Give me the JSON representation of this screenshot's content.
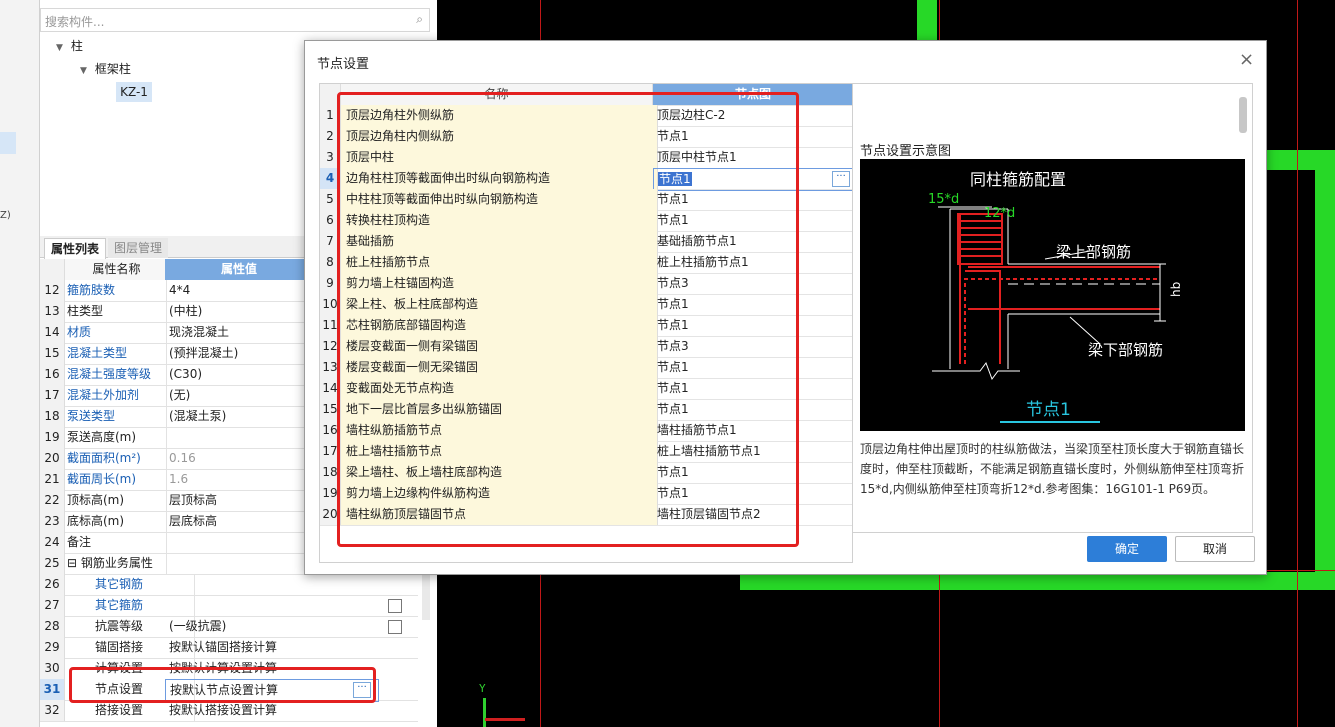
{
  "left_panel": {
    "search_placeholder": "搜索构件...",
    "tree": {
      "root": "柱",
      "child": "框架柱",
      "leaf": "KZ-1"
    },
    "tabs": [
      "属性列表",
      "图层管理"
    ],
    "header": {
      "name": "属性名称",
      "value": "属性值"
    },
    "rows": [
      {
        "num": "12",
        "name": "箍筋肢数",
        "value": "4*4",
        "name_color": "blue"
      },
      {
        "num": "13",
        "name": "柱类型",
        "value": "(中柱)"
      },
      {
        "num": "14",
        "name": "材质",
        "value": "现浇混凝土",
        "name_color": "blue"
      },
      {
        "num": "15",
        "name": "混凝土类型",
        "value": "(预拌混凝土)",
        "name_color": "blue"
      },
      {
        "num": "16",
        "name": "混凝土强度等级",
        "value": "(C30)",
        "name_color": "blue"
      },
      {
        "num": "17",
        "name": "混凝土外加剂",
        "value": "(无)",
        "name_color": "blue"
      },
      {
        "num": "18",
        "name": "泵送类型",
        "value": "(混凝土泵)",
        "name_color": "blue"
      },
      {
        "num": "19",
        "name": "泵送高度(m)",
        "value": ""
      },
      {
        "num": "20",
        "name": "截面面积(m²)",
        "value": "0.16",
        "name_color": "blue",
        "value_color": "gray"
      },
      {
        "num": "21",
        "name": "截面周长(m)",
        "value": "1.6",
        "name_color": "blue",
        "value_color": "gray"
      },
      {
        "num": "22",
        "name": "顶标高(m)",
        "value": "层顶标高"
      },
      {
        "num": "23",
        "name": "底标高(m)",
        "value": "层底标高"
      },
      {
        "num": "24",
        "name": "备注",
        "value": ""
      },
      {
        "num": "25",
        "name": "⊟ 钢筋业务属性",
        "value": ""
      },
      {
        "num": "26",
        "name": "其它钢筋",
        "value": "",
        "name_color": "blue",
        "indent": true
      },
      {
        "num": "27",
        "name": "其它箍筋",
        "value": "",
        "name_color": "blue",
        "indent": true,
        "checkbox": true
      },
      {
        "num": "28",
        "name": "抗震等级",
        "value": "(一级抗震)",
        "indent": true,
        "checkbox": true
      },
      {
        "num": "29",
        "name": "锚固搭接",
        "value": "按默认锚固搭接计算",
        "indent": true
      },
      {
        "num": "30",
        "name": "计算设置",
        "value": "按默认计算设置计算",
        "indent": true
      },
      {
        "num": "31",
        "name": "节点设置",
        "value": "按默认节点设置计算",
        "indent": true,
        "selected": true
      },
      {
        "num": "32",
        "name": "搭接设置",
        "value": "按默认搭接设置计算",
        "indent": true
      }
    ]
  },
  "dialog": {
    "title": "节点设置",
    "close_glyph": "×",
    "header": {
      "name": "名称",
      "value": "节点图"
    },
    "rows": [
      {
        "num": "1",
        "name": "顶层边角柱外侧纵筋",
        "value": "顶层边柱C-2"
      },
      {
        "num": "2",
        "name": "顶层边角柱内侧纵筋",
        "value": "节点1"
      },
      {
        "num": "3",
        "name": "顶层中柱",
        "value": "顶层中柱节点1"
      },
      {
        "num": "4",
        "name": "边角柱柱顶等截面伸出时纵向钢筋构造",
        "value": "节点1",
        "selected": true
      },
      {
        "num": "5",
        "name": "中柱柱顶等截面伸出时纵向钢筋构造",
        "value": "节点1"
      },
      {
        "num": "6",
        "name": "转换柱柱顶构造",
        "value": "节点1"
      },
      {
        "num": "7",
        "name": "基础插筋",
        "value": "基础插筋节点1"
      },
      {
        "num": "8",
        "name": "桩上柱插筋节点",
        "value": "桩上柱插筋节点1"
      },
      {
        "num": "9",
        "name": "剪力墙上柱锚固构造",
        "value": "节点3"
      },
      {
        "num": "10",
        "name": "梁上柱、板上柱底部构造",
        "value": "节点1"
      },
      {
        "num": "11",
        "name": "芯柱钢筋底部锚固构造",
        "value": "节点1"
      },
      {
        "num": "12",
        "name": "楼层变截面一侧有梁锚固",
        "value": "节点3"
      },
      {
        "num": "13",
        "name": "楼层变截面一侧无梁锚固",
        "value": "节点1"
      },
      {
        "num": "14",
        "name": "变截面处无节点构造",
        "value": "节点1"
      },
      {
        "num": "15",
        "name": "地下一层比首层多出纵筋锚固",
        "value": "节点1"
      },
      {
        "num": "16",
        "name": "墙柱纵筋插筋节点",
        "value": "墙柱插筋节点1"
      },
      {
        "num": "17",
        "name": "桩上墙柱插筋节点",
        "value": "桩上墙柱插筋节点1"
      },
      {
        "num": "18",
        "name": "梁上墙柱、板上墙柱底部构造",
        "value": "节点1"
      },
      {
        "num": "19",
        "name": "剪力墙上边缘构件纵筋构造",
        "value": "节点1"
      },
      {
        "num": "20",
        "name": "墙柱纵筋顶层锚固节点",
        "value": "墙柱顶层锚固节点2"
      }
    ],
    "diagram_title": "节点设置示意图",
    "diagram_labels": {
      "hoop": "同柱箍筋配置",
      "len1": "15*d",
      "len2": "12*d",
      "top_bar": "梁上部钢筋",
      "bottom_bar": "梁下部钢筋",
      "hb": "hb",
      "caption": "节点1"
    },
    "description": "顶层边角柱伸出屋顶时的柱纵筋做法，当梁顶至柱顶长度大于钢筋直锚长度时，伸至柱顶截断，不能满足钢筋直锚长度时，外侧纵筋伸至柱顶弯折15*d,内侧纵筋伸至柱顶弯折12*d.参考图集：16G101-1 P69页。",
    "ok": "确定",
    "cancel": "取消"
  },
  "canvas": {
    "axis_y": "Y"
  },
  "colors": {
    "cad_green": "#27d827",
    "cad_red": "#e32020",
    "accent": "#2d7ed8",
    "header_blue": "#79a9e0"
  }
}
